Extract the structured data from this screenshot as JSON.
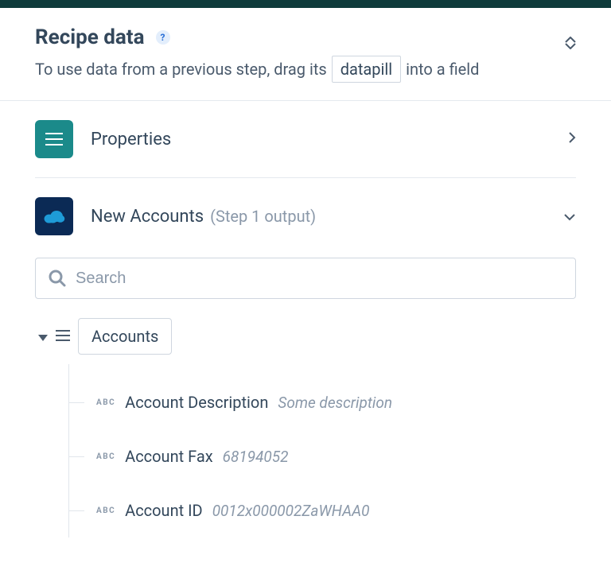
{
  "header": {
    "title": "Recipe data",
    "instruction_pre": "To use data from a previous step, drag its",
    "pill": "datapill",
    "instruction_post": "into a field"
  },
  "sections": {
    "properties": {
      "label": "Properties"
    },
    "new_accounts": {
      "label": "New Accounts",
      "note": "(Step 1 output)"
    }
  },
  "search": {
    "placeholder": "Search"
  },
  "tree": {
    "root": "Accounts",
    "type_badge": "ABC",
    "items": [
      {
        "name": "Account Description",
        "value": "Some description"
      },
      {
        "name": "Account Fax",
        "value": "68194052"
      },
      {
        "name": "Account ID",
        "value": "0012x000002ZaWHAA0"
      }
    ]
  }
}
